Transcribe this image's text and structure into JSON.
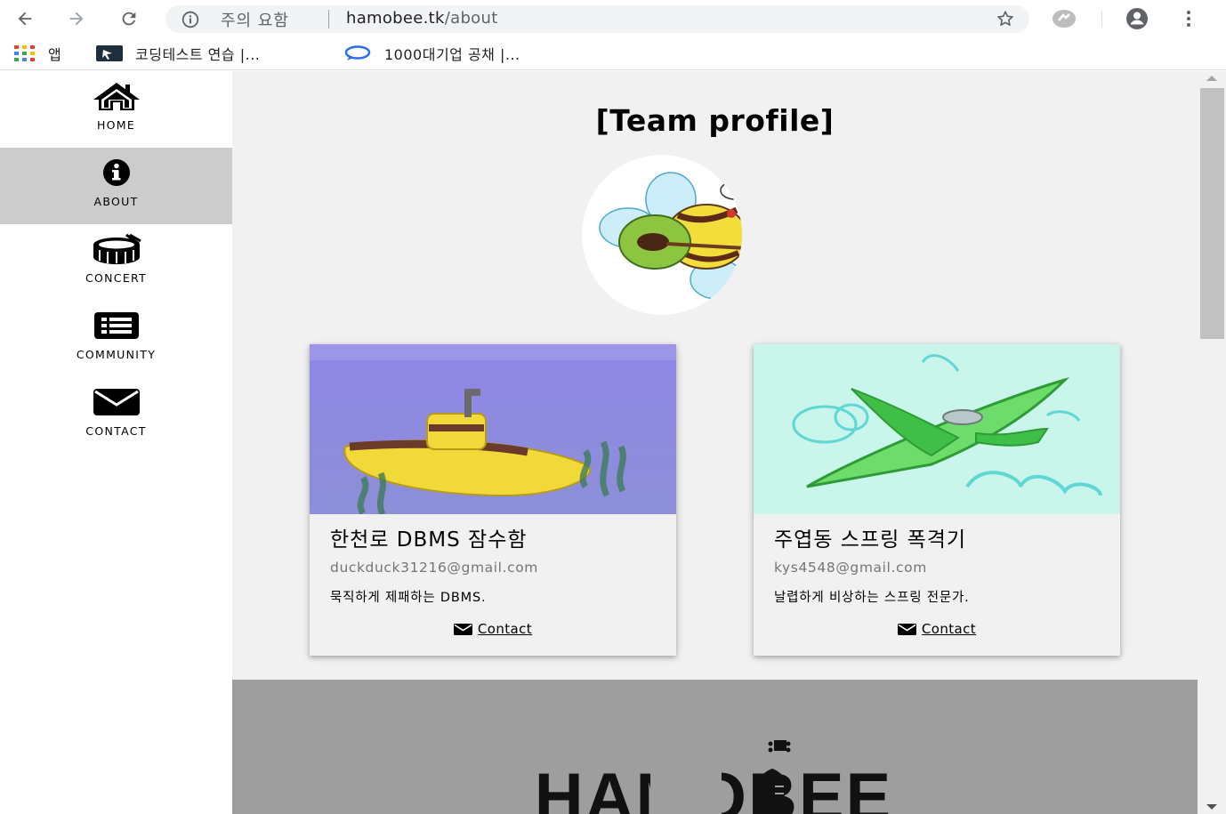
{
  "browser": {
    "security_label": "주의 요함",
    "url_host": "hamobee.tk",
    "url_path": "/about"
  },
  "bookmarks": [
    {
      "label": "앱",
      "icon": "apps-grid-icon"
    },
    {
      "label": "코딩테스트 연습 |...",
      "icon": "bookmark-favicon-icon"
    },
    {
      "label": "1000대기업 공채 |...",
      "icon": "bookmark-favicon-icon"
    }
  ],
  "sidebar": {
    "items": [
      {
        "label": "HOME",
        "icon": "home-icon"
      },
      {
        "label": "ABOUT",
        "icon": "info-icon",
        "active": true
      },
      {
        "label": "CONCERT",
        "icon": "drum-icon"
      },
      {
        "label": "COMMUNITY",
        "icon": "list-icon"
      },
      {
        "label": "CONTACT",
        "icon": "envelope-icon"
      }
    ]
  },
  "main": {
    "title": "[Team profile]",
    "members": [
      {
        "name": "한천로 DBMS 잠수함",
        "email": "duckduck31216@gmail.com",
        "description": "묵직하게 제패하는 DBMS.",
        "contact_label": " Contact"
      },
      {
        "name": "주엽동 스프링 폭격기",
        "email": "kys4548@gmail.com",
        "description": "날렵하게 비상하는 스프링 전문가.",
        "contact_label": " Contact"
      }
    ]
  },
  "footer": {
    "logo_text": "HAMOBEE"
  },
  "colors": {
    "content_bg": "#f1f1f1",
    "active_nav_bg": "#cccccc",
    "footer_bg": "#9e9e9e",
    "email_text": "#757575"
  }
}
